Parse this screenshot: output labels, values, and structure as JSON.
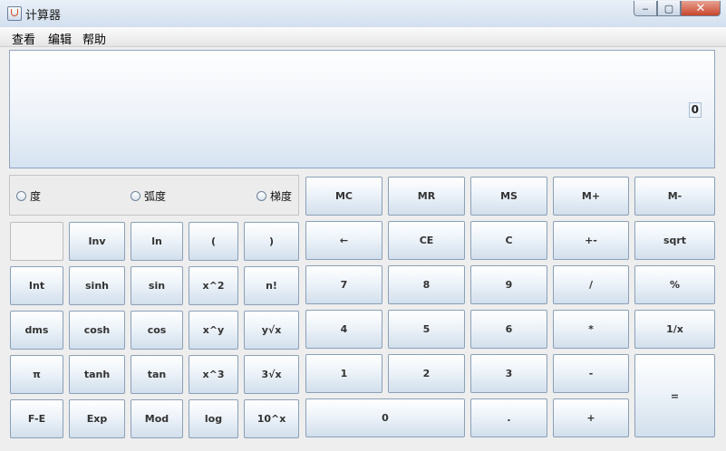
{
  "window": {
    "title": "计算器",
    "controls": {
      "minimize": "‒",
      "maximize": "▢",
      "close": "✕"
    }
  },
  "menu": [
    "查看",
    "编辑",
    "帮助"
  ],
  "display": {
    "value": "0"
  },
  "angle_modes": [
    "度",
    "弧度",
    "梯度"
  ],
  "memory_keys": [
    "MC",
    "MR",
    "MS",
    "M+",
    "M-"
  ],
  "function_keys": [
    [
      "",
      "Inv",
      "ln",
      "(",
      ")"
    ],
    [
      "Int",
      "sinh",
      "sin",
      "x^2",
      "n!"
    ],
    [
      "dms",
      "cosh",
      "cos",
      "x^y",
      "y√x"
    ],
    [
      "π",
      "tanh",
      "tan",
      "x^3",
      "3√x"
    ],
    [
      "F-E",
      "Exp",
      "Mod",
      "log",
      "10^x"
    ]
  ],
  "edit_keys": [
    "←",
    "CE",
    "C",
    "+-",
    "sqrt"
  ],
  "num_keys": {
    "row1": [
      "7",
      "8",
      "9",
      "/",
      "%"
    ],
    "row2": [
      "4",
      "5",
      "6",
      "*",
      "1/x"
    ],
    "row3": [
      "1",
      "2",
      "3",
      "-"
    ],
    "row4": [
      "0",
      ".",
      "+"
    ],
    "equals": "="
  }
}
